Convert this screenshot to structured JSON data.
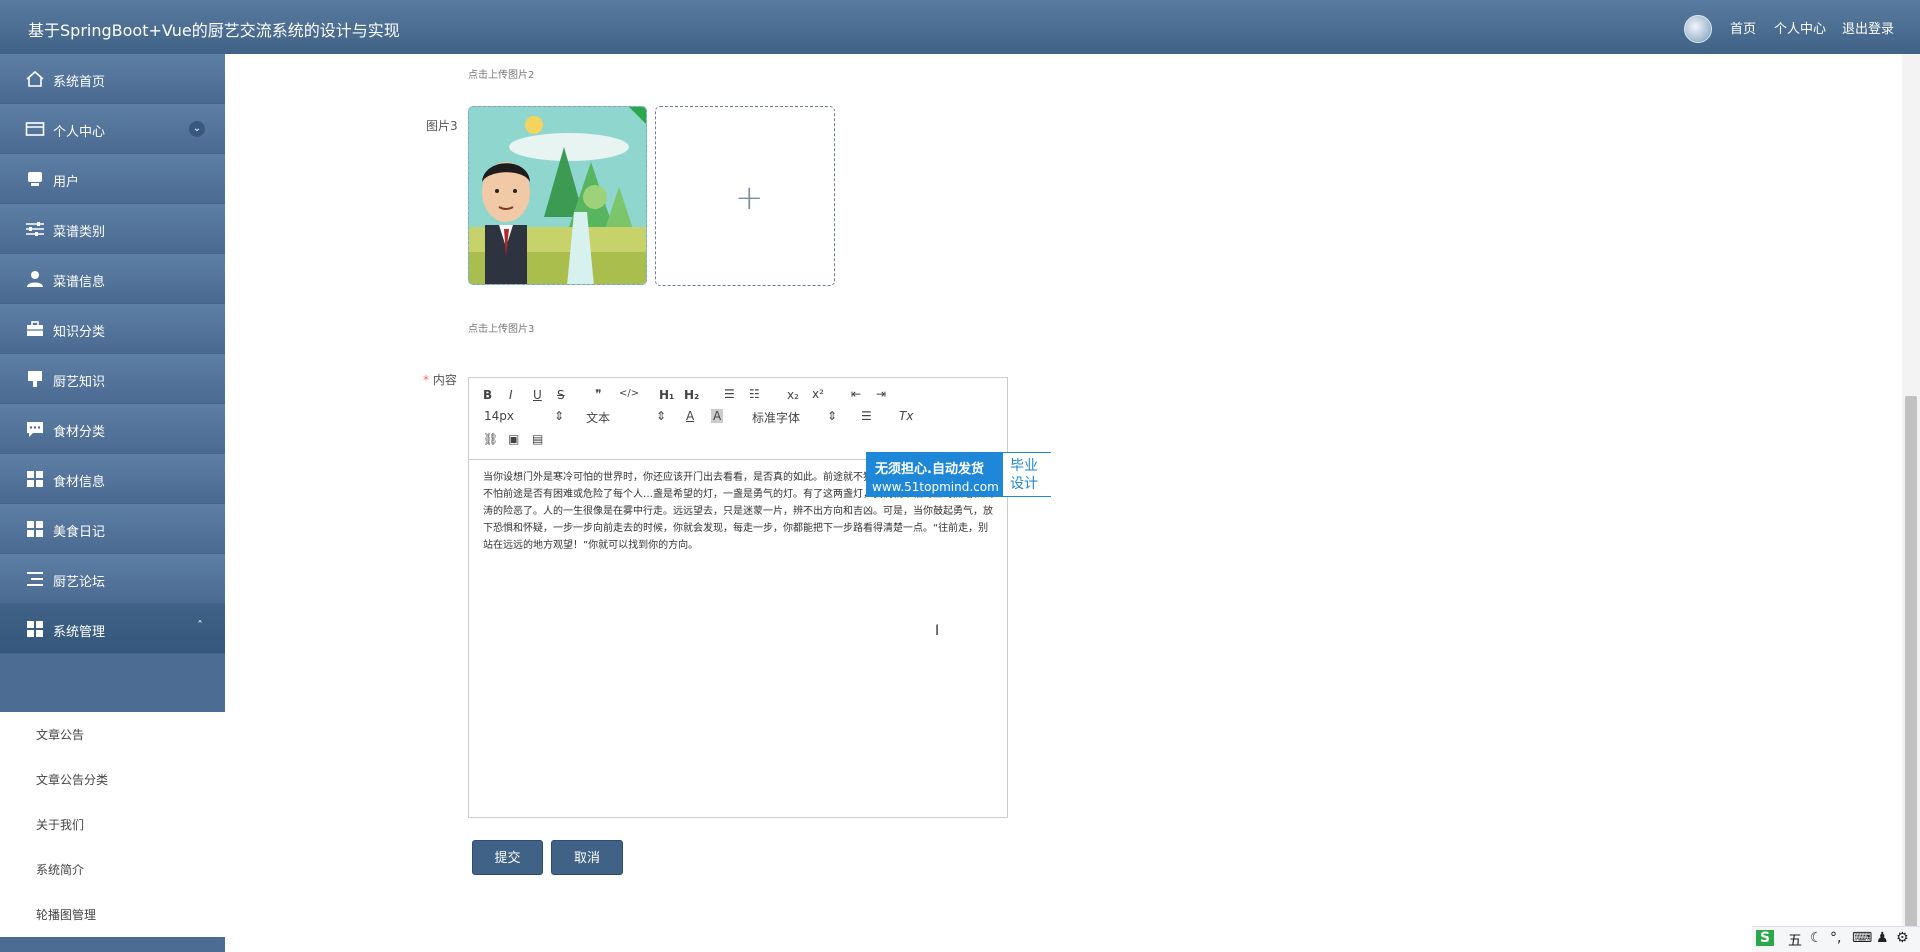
{
  "header": {
    "title": "基于SpringBoot+Vue的厨艺交流系统的设计与实现",
    "nav": [
      "首页",
      "个人中心",
      "退出登录"
    ]
  },
  "sidebar": {
    "items": [
      {
        "label": "系统首页",
        "icon": "home-icon"
      },
      {
        "label": "个人中心",
        "icon": "card-icon"
      },
      {
        "label": "用户",
        "icon": "monitor-icon"
      },
      {
        "label": "菜谱类别",
        "icon": "sliders-icon"
      },
      {
        "label": "菜谱信息",
        "icon": "user-icon"
      },
      {
        "label": "知识分类",
        "icon": "briefcase-icon"
      },
      {
        "label": "厨艺知识",
        "icon": "board-icon"
      },
      {
        "label": "食材分类",
        "icon": "chat-icon"
      },
      {
        "label": "食材信息",
        "icon": "grid-icon"
      },
      {
        "label": "美食日记",
        "icon": "grid-icon"
      },
      {
        "label": "厨艺论坛",
        "icon": "list-icon"
      },
      {
        "label": "系统管理",
        "icon": "grid-icon"
      }
    ],
    "submenu": [
      "文章公告",
      "文章公告分类",
      "关于我们",
      "系统简介",
      "轮播图管理"
    ]
  },
  "form": {
    "hint2": "点击上传图片2",
    "image3_label": "图片3",
    "hint3": "点击上传图片3",
    "content_label": "内容",
    "required_mark": "*"
  },
  "editor": {
    "toolbar": {
      "bold": "B",
      "italic": "I",
      "underline": "U",
      "strike": "S",
      "quote": "❞",
      "code": "</>",
      "h1": "H₁",
      "h2": "H₂",
      "ol": "☰",
      "ul": "☷",
      "sub": "x₂",
      "sup": "x²",
      "outdent": "⇤",
      "indent": "⇥",
      "size": "14px",
      "header": "文本",
      "font": "标准字体",
      "color": "A",
      "bg": "A",
      "align": "☰",
      "clean": "Tx",
      "link": "⛓",
      "image": "▣",
      "video": "▤"
    },
    "content": "当你设想门外是寒冷可怕的世界时，你还应该开门出去看看，是否真的如此。前途就不犹豫了。如果你有勇气，你就不怕前途是否有困难或危险了每个人…盏是希望的灯，一盏是勇气的灯。有了这两盏灯，我们就不怕海上的黑暗和风涛的险恶了。人的一生很像是在雾中行走。远远望去，只是迷蒙一片，辨不出方向和吉凶。可是，当你鼓起勇气，放下恐惧和怀疑，一步一步向前走去的时候，你就会发现，每走一步，你都能把下一步路看得清楚一点。“往前走，别站在远远的地方观望！”你就可以找到你的方向。"
  },
  "watermark": {
    "line1": "无须担心.自动发货",
    "line2": "www.51topmind.com",
    "right": "毕业设计"
  },
  "buttons": {
    "submit": "提交",
    "cancel": "取消"
  },
  "ime": {
    "mode": "五"
  }
}
